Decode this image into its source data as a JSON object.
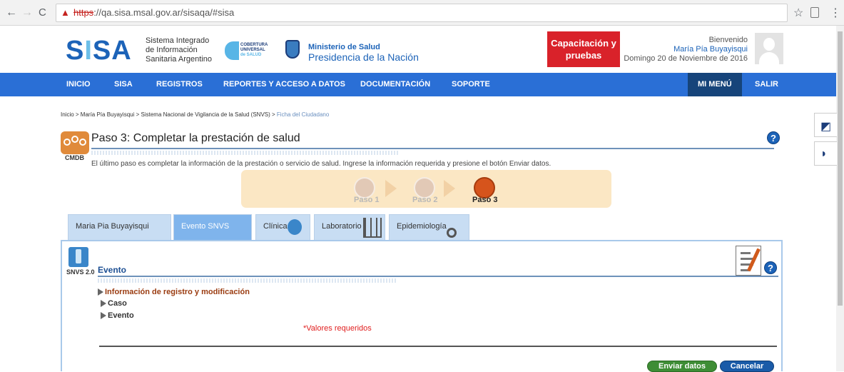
{
  "browser": {
    "url_scheme": "https",
    "url_rest": "://qa.sisa.msal.gov.ar/sisaqa/#sisa"
  },
  "header": {
    "logo": "SISA",
    "sisa_line1": "Sistema Integrado",
    "sisa_line2": "de Información",
    "sisa_line3": "Sanitaria Argentino",
    "cobertura_line1": "COBERTURA",
    "cobertura_line2": "UNIVERSAL",
    "cobertura_line3": "de SALUD",
    "ministerio": "Ministerio de Salud",
    "presidencia": "Presidencia de la Nación",
    "capacitacion": "Capacitación y pruebas",
    "welcome": "Bienvenido",
    "user": "María Pía Buyayisqui",
    "date": "Domingo 20 de Noviembre de 2016"
  },
  "nav": {
    "items": [
      "INICIO",
      "SISA",
      "REGISTROS",
      "REPORTES Y ACCESO A DATOS",
      "DOCUMENTACIÓN",
      "SOPORTE"
    ],
    "mi_menu": "MI MENÚ",
    "salir": "SALIR"
  },
  "breadcrumb": {
    "path": "Inicio > María Pía Buyayisqui > Sistema Nacional de Vigilancia de la Salud (SNVS) > ",
    "current": "Ficha del Ciudadano"
  },
  "page": {
    "icon_label": "CMDB",
    "title": "Paso 3: Completar la prestación de salud",
    "instructions": "El último paso es completar la información de la prestación o servicio de salud. Ingrese la información requerida y presione el botón Enviar datos."
  },
  "steps": [
    {
      "label": "Paso 1",
      "active": false
    },
    {
      "label": "Paso 2",
      "active": false
    },
    {
      "label": "Paso 3",
      "active": true
    }
  ],
  "tabs": [
    {
      "label": "Maria Pia Buyayisqui",
      "active": false
    },
    {
      "label": "Evento SNVS",
      "active": true
    },
    {
      "label": "Clínica",
      "active": false
    },
    {
      "label": "Laboratorio",
      "active": false
    },
    {
      "label": "Epidemiología",
      "active": false
    }
  ],
  "panel": {
    "icon_label": "SNVS 2.0",
    "title": "Evento",
    "sections": [
      "Información de registro y modificación",
      "Caso",
      "Evento"
    ],
    "required_note": "*Valores requeridos",
    "submit": "Enviar datos",
    "cancel": "Cancelar"
  },
  "colors": {
    "nav_blue": "#2a6fd6",
    "mi_menu": "#16447a",
    "capacitacion_red": "#d9222a",
    "step_active": "#d6541c",
    "submit_green": "#3e8d35",
    "cancel_blue": "#1a5ba8"
  }
}
